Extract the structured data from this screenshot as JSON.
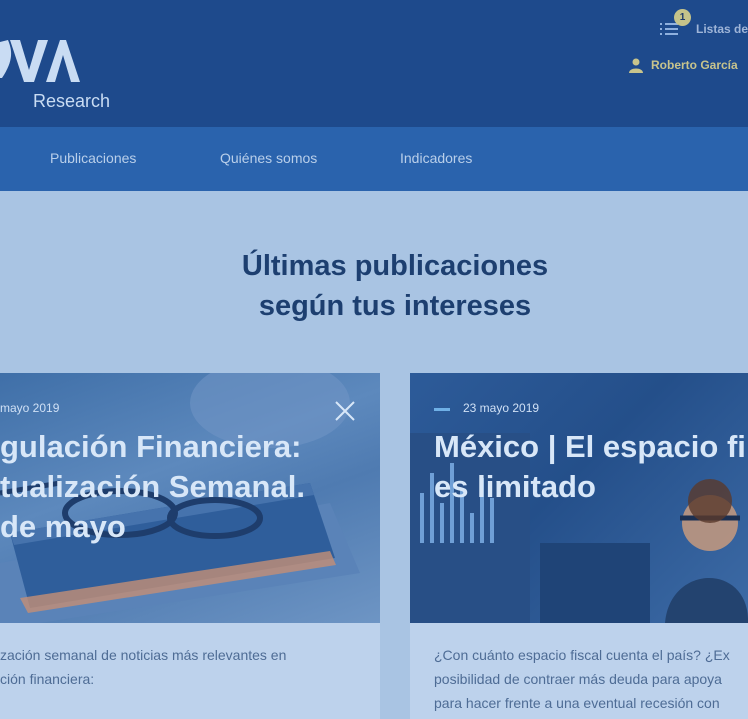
{
  "header": {
    "logo_text": "Research",
    "lists_badge": "1",
    "lists_label": "Listas de",
    "user_name": "Roberto García"
  },
  "nav": {
    "items": [
      {
        "label": "Publicaciones"
      },
      {
        "label": "Quiénes somos"
      },
      {
        "label": "Indicadores"
      }
    ]
  },
  "section": {
    "title_line1": "Últimas publicaciones",
    "title_line2": "según tus intereses"
  },
  "cards": [
    {
      "date": "mayo 2019",
      "title_lines": [
        "gulación Financiera:",
        "tualización Semanal.",
        "de mayo"
      ],
      "text_lines": [
        "zación semanal de noticias más relevantes en",
        "ción financiera:"
      ]
    },
    {
      "date": "23 mayo 2019",
      "title_lines": [
        "México | El espacio fi",
        "es limitado"
      ],
      "text_lines": [
        "¿Con cuánto espacio fiscal cuenta el país? ¿Ex",
        "posibilidad de contraer más deuda para apoya",
        "para hacer frente a una eventual recesión con"
      ]
    }
  ],
  "colors": {
    "header_bg": "#1e4a8c",
    "nav_bg": "#2a63ad",
    "page_bg": "#a9c4e3",
    "accent_gold": "#c8c48c"
  }
}
